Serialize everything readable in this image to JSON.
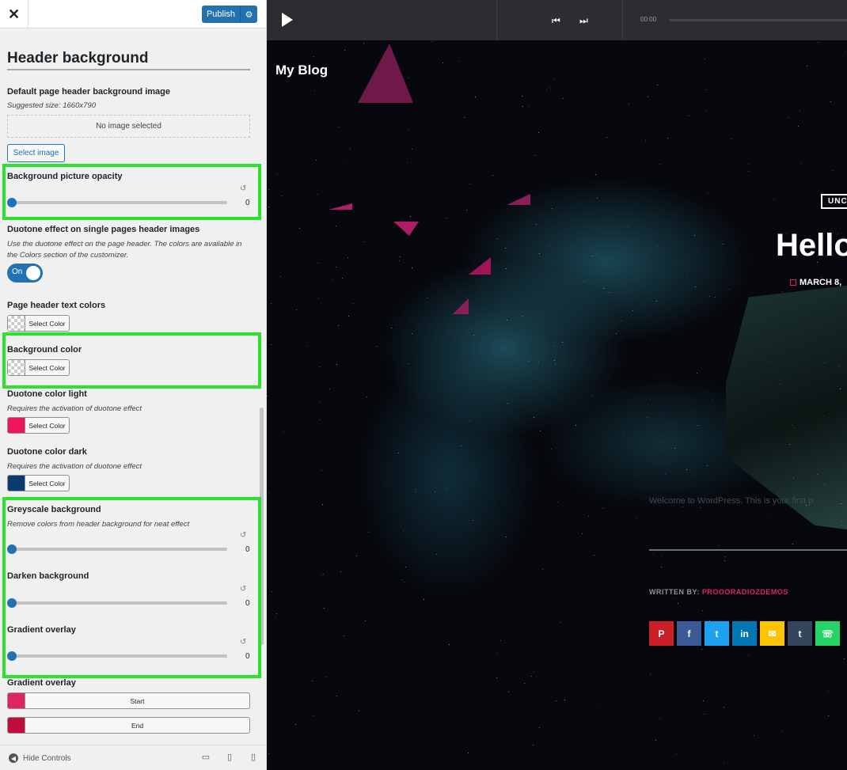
{
  "sidebar": {
    "publish_label": "Publish",
    "section_title": "Header background",
    "default_image": {
      "label": "Default page header background image",
      "suggested": "Suggested size: 1660x790",
      "no_image": "No image selected",
      "select_label": "Select image"
    },
    "picture_opacity": {
      "label": "Background picture opacity",
      "value": "0"
    },
    "duotone_effect": {
      "label": "Duotone effect on single pages header images",
      "desc": "Use the duotone effect on the page header. The colors are available in the Colors section of the customizer.",
      "toggle_label": "On"
    },
    "text_colors": {
      "label": "Page header text colors",
      "button": "Select Color"
    },
    "background_color": {
      "label": "Background color",
      "button": "Select Color"
    },
    "duotone_light": {
      "label": "Duotone color light",
      "desc": "Requires the activation of duotone effect",
      "button": "Select Color",
      "color": "#f0145a"
    },
    "duotone_dark": {
      "label": "Duotone color dark",
      "desc": "Requires the activation of duotone effect",
      "button": "Select Color",
      "color": "#0d3a6e"
    },
    "greyscale": {
      "label": "Greyscale background",
      "desc": "Remove colors from header background for neat effect",
      "value": "0"
    },
    "darken": {
      "label": "Darken background",
      "value": "0"
    },
    "gradient_slider": {
      "label": "Gradient overlay",
      "value": "0"
    },
    "gradient_colors": {
      "label": "Gradient overlay",
      "start_label": "Start",
      "start_color": "#e0245e",
      "end_label": "End",
      "end_color": "#c00c3a"
    },
    "hide_controls": "Hide Controls",
    "highlight_color": "#2fe12f"
  },
  "preview": {
    "player": {
      "time": "00:00"
    },
    "site_title": "My Blog",
    "category": "UNC",
    "post_title": "Hello",
    "post_date": "MARCH 8,",
    "excerpt": "Welcome to WordPress. This is your first p",
    "author_prefix": "WRITTEN BY:",
    "author_name": "PROOORADIOZDEMOS",
    "share": [
      {
        "icon": "pinterest-icon",
        "glyph": "P",
        "color": "#cb2027"
      },
      {
        "icon": "facebook-icon",
        "glyph": "f",
        "color": "#3b5998"
      },
      {
        "icon": "twitter-icon",
        "glyph": "t",
        "color": "#1da1f2"
      },
      {
        "icon": "linkedin-icon",
        "glyph": "in",
        "color": "#0077b5"
      },
      {
        "icon": "email-icon",
        "glyph": "✉",
        "color": "#ffc300"
      },
      {
        "icon": "tumblr-icon",
        "glyph": "t",
        "color": "#35465c"
      },
      {
        "icon": "whatsapp-icon",
        "glyph": "☏",
        "color": "#25d366"
      }
    ]
  }
}
